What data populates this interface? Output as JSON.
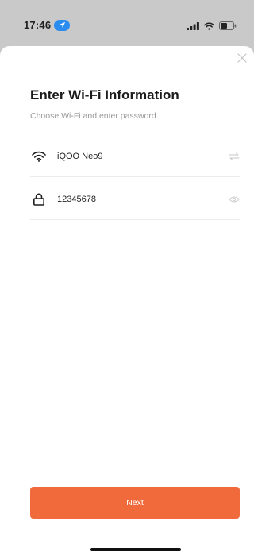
{
  "status_bar": {
    "time": "17:46",
    "location_icon": "location-arrow-icon",
    "signal_icon": "cellular-signal-icon",
    "wifi_icon": "wifi-icon",
    "battery_icon": "battery-icon"
  },
  "sheet": {
    "close_icon": "close-icon",
    "title": "Enter Wi-Fi Information",
    "subtitle": "Choose Wi-Fi and enter password",
    "wifi_field": {
      "icon": "wifi-icon",
      "value": "iQOO Neo9",
      "action_icon": "switch-network-icon"
    },
    "password_field": {
      "icon": "lock-icon",
      "value": "12345678",
      "action_icon": "eye-icon"
    },
    "next_label": "Next"
  },
  "colors": {
    "accent": "#f06a3c",
    "status_background": "#c9c9c9",
    "location_pill": "#2b8cf0"
  }
}
